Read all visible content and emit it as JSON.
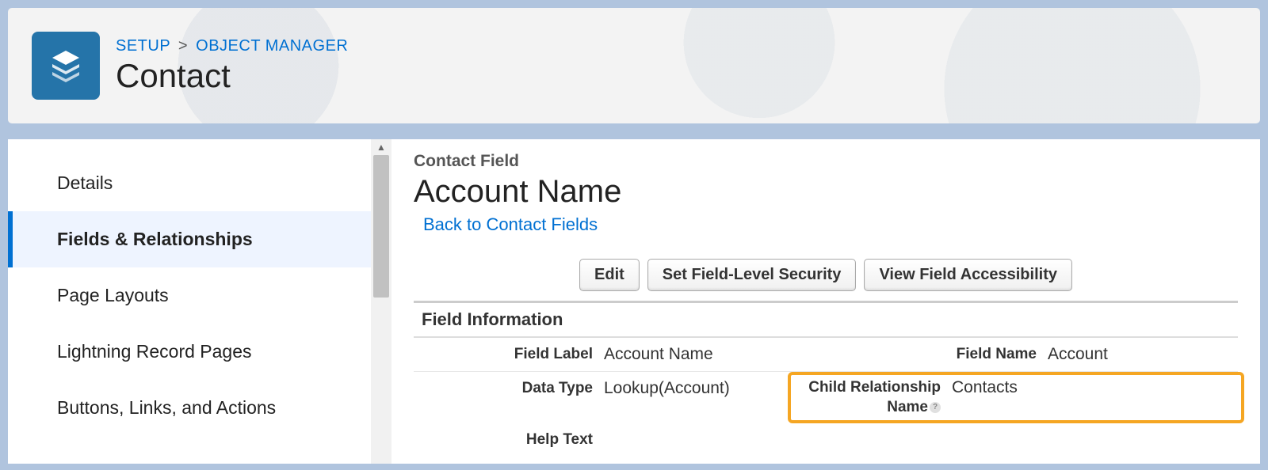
{
  "breadcrumb": {
    "setup": "SETUP",
    "separator": ">",
    "object_manager": "OBJECT MANAGER"
  },
  "page_title": "Contact",
  "sidebar": {
    "items": [
      {
        "label": "Details",
        "active": false
      },
      {
        "label": "Fields & Relationships",
        "active": true
      },
      {
        "label": "Page Layouts",
        "active": false
      },
      {
        "label": "Lightning Record Pages",
        "active": false
      },
      {
        "label": "Buttons, Links, and Actions",
        "active": false
      }
    ]
  },
  "main": {
    "section_label": "Contact Field",
    "field_title": "Account Name",
    "back_link": "Back to Contact Fields",
    "buttons": {
      "edit": "Edit",
      "security": "Set Field-Level Security",
      "accessibility": "View Field Accessibility"
    },
    "section_header": "Field Information",
    "info": {
      "field_label_lbl": "Field Label",
      "field_label_val": "Account Name",
      "field_name_lbl": "Field Name",
      "field_name_val": "Account",
      "data_type_lbl": "Data Type",
      "data_type_val": "Lookup(Account)",
      "child_rel_lbl": "Child Relationship Name",
      "child_rel_val": "Contacts",
      "help_text_lbl": "Help Text"
    }
  }
}
